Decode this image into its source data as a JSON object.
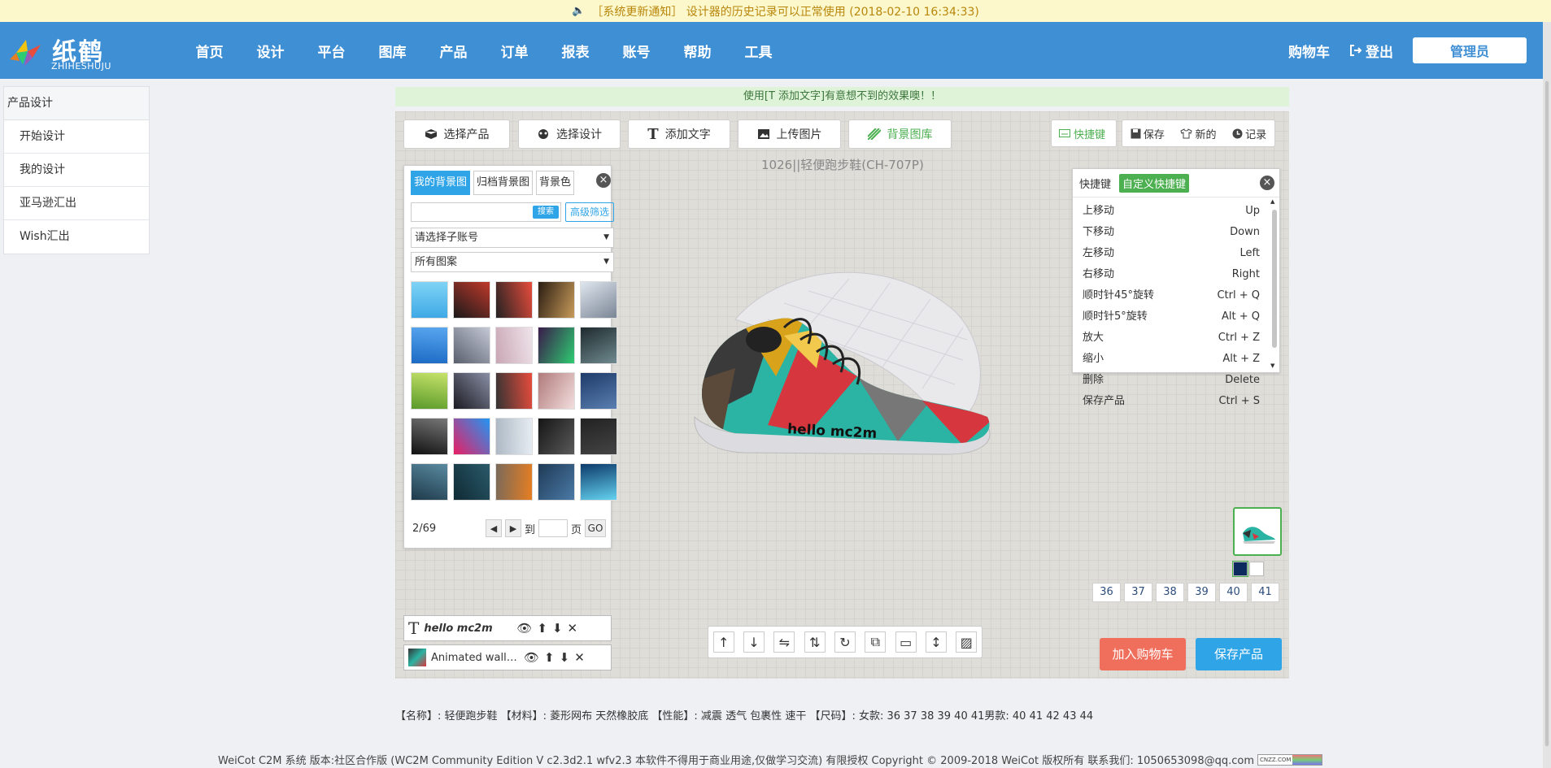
{
  "notice": {
    "text": "［系统更新通知］ 设计器的历史记录可以正常使用 (2018-02-10 16:34:33)"
  },
  "brand": {
    "name_cn": "纸鹤",
    "name_en": "ZHIHESHUJU"
  },
  "nav": {
    "items": [
      "首页",
      "设计",
      "平台",
      "图库",
      "产品",
      "订单",
      "报表",
      "账号",
      "帮助",
      "工具"
    ]
  },
  "header_right": {
    "cart": "购物车",
    "logout": "登出",
    "admin": "管理员"
  },
  "sidebar": {
    "title": "产品设计",
    "items": [
      "开始设计",
      "我的设计",
      "亚马逊汇出",
      "Wish汇出"
    ]
  },
  "tip": "使用[T 添加文字]有意想不到的效果噢！！",
  "toolbar": {
    "select_product": "选择产品",
    "select_design": "选择设计",
    "add_text": "添加文字",
    "upload_image": "上传图片",
    "bg_library": "背景图库",
    "shortcuts": "快捷键",
    "save": "保存",
    "new": "新的",
    "history": "记录"
  },
  "product_title": "1026||轻便跑步鞋(CH-707P)",
  "bg_panel": {
    "tabs": [
      "我的背景图",
      "归档背景图",
      "背景色"
    ],
    "search_value": "",
    "search_btn": "搜索",
    "adv_filter": "高级筛选",
    "sub_account": "请选择子账号",
    "pattern": "所有图案",
    "page_info": "2/69",
    "goto_label": "到",
    "page_label": "页",
    "go_btn": "GO",
    "page_input": ""
  },
  "thumb_colors": [
    [
      "#3fa9e6",
      "#7fd3f5"
    ],
    [
      "#1a1a1a",
      "#c0392b"
    ],
    [
      "#222",
      "#e74c3c"
    ],
    [
      "#2b1d12",
      "#c89b5a"
    ],
    [
      "#dfe6ee",
      "#7a8595"
    ],
    [
      "#1c6ac4",
      "#59a7f0"
    ],
    [
      "#5a5f6e",
      "#c5c9d6"
    ],
    [
      "#c9a7b4",
      "#efe3ea"
    ],
    [
      "#3a1a4a",
      "#2ecc71"
    ],
    [
      "#1e2a2e",
      "#6f8a8f"
    ],
    [
      "#5a9a2a",
      "#c7e36a"
    ],
    [
      "#1a1a22",
      "#8a8fa5"
    ],
    [
      "#333",
      "#e74c3c"
    ],
    [
      "#b07a7a",
      "#f3dede"
    ],
    [
      "#1d3a6a",
      "#5a7fb0"
    ],
    [
      "#111",
      "#777"
    ],
    [
      "#e91e63",
      "#2196f3"
    ],
    [
      "#aeb9c5",
      "#e6ecf2"
    ],
    [
      "#151515",
      "#5a5a5a"
    ],
    [
      "#222",
      "#444"
    ],
    [
      "#1e3a4a",
      "#5a8aa0"
    ],
    [
      "#0f2a34",
      "#2a5a6a"
    ],
    [
      "#7a6a5a",
      "#e67e22"
    ],
    [
      "#1f3a56",
      "#4a7aa6"
    ],
    [
      "#0d3a6a",
      "#64d2f0"
    ]
  ],
  "shortcut_panel": {
    "tabs": [
      "快捷键",
      "自定义快捷键"
    ],
    "rows": [
      {
        "action": "上移动",
        "key": "Up"
      },
      {
        "action": "下移动",
        "key": "Down"
      },
      {
        "action": "左移动",
        "key": "Left"
      },
      {
        "action": "右移动",
        "key": "Right"
      },
      {
        "action": "顺时针45°旋转",
        "key": "Ctrl + Q"
      },
      {
        "action": "顺时针5°旋转",
        "key": "Alt + Q"
      },
      {
        "action": "放大",
        "key": "Ctrl + Z"
      },
      {
        "action": "缩小",
        "key": "Alt + Z"
      },
      {
        "action": "删除",
        "key": "Delete"
      },
      {
        "action": "保存产品",
        "key": "Ctrl + S"
      }
    ]
  },
  "shoe_text": "hello mc2m",
  "sizes": [
    "36",
    "37",
    "38",
    "39",
    "40",
    "41"
  ],
  "swatches": [
    "#0d2a5e",
    "#ffffff"
  ],
  "layers": [
    {
      "type": "text",
      "label": "hello mc2m"
    },
    {
      "type": "image",
      "label": "Animated wallp..."
    }
  ],
  "actions": {
    "add_cart": "加入购物车",
    "save_product": "保存产品"
  },
  "spec": "【名称】: 轻便跑步鞋 【材料】: 菱形网布 天然橡胶底 【性能】: 减震 透气 包裹性 速干 【尺码】: 女款: 36 37 38 39 40 41男款: 40 41 42 43 44",
  "footer": "WeiCot C2M 系统 版本:社区合作版 (WC2M Community Edition V c2.3d2.1 wfv2.3 本软件不得用于商业用途,仅做学习交流) 有限授权 Copyright © 2009-2018 WeiCot 版权所有 联系我们: 1050653098@qq.com",
  "cnzz_label": "CNZZ.COM",
  "colors": {
    "nav_bg": "#3f8fd5",
    "primary": "#2fa4e7",
    "green": "#4caf50",
    "cart": "#f06e5c"
  }
}
